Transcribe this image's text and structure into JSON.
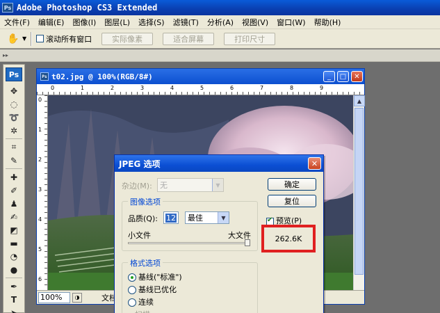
{
  "app": {
    "title": "Adobe Photoshop CS3 Extended",
    "badge": "Ps"
  },
  "menu": [
    "文件(F)",
    "编辑(E)",
    "图像(I)",
    "图层(L)",
    "选择(S)",
    "滤镜(T)",
    "分析(A)",
    "视图(V)",
    "窗口(W)",
    "帮助(H)"
  ],
  "options": {
    "scroll_all_label": "滚动所有窗口",
    "buttons": [
      "实际像素",
      "适合屏幕",
      "打印尺寸"
    ]
  },
  "toolbox": {
    "logo": "Ps"
  },
  "document": {
    "title": "t02.jpg @ 100%(RGB/8#)",
    "ruler_top": [
      "0",
      "1",
      "2",
      "3",
      "4",
      "5",
      "6",
      "7",
      "8",
      "9"
    ],
    "ruler_left": [
      "0",
      "1",
      "2",
      "3",
      "4",
      "5",
      "6"
    ],
    "zoom": "100%",
    "status": "文档"
  },
  "jpeg_dialog": {
    "title": "JPEG 选项",
    "matte_label": "杂边(M):",
    "matte_value": "无",
    "image_options_label": "图像选项",
    "quality_label": "品质(Q):",
    "quality_value": "12",
    "quality_preset": "最佳",
    "small_file": "小文件",
    "large_file": "大文件",
    "quality_slider_fraction": 1.0,
    "format_options_label": "格式选项",
    "format_options": [
      {
        "label": "基线(\"标准\")",
        "selected": true
      },
      {
        "label": "基线已优化",
        "selected": false
      },
      {
        "label": "连续",
        "selected": false
      }
    ],
    "scan_label": "扫描",
    "ok_label": "确定",
    "reset_label": "复位",
    "preview_label": "预览(P)",
    "preview_checked": true,
    "file_size": "262.6K",
    "highlight_color": "#e02020"
  }
}
